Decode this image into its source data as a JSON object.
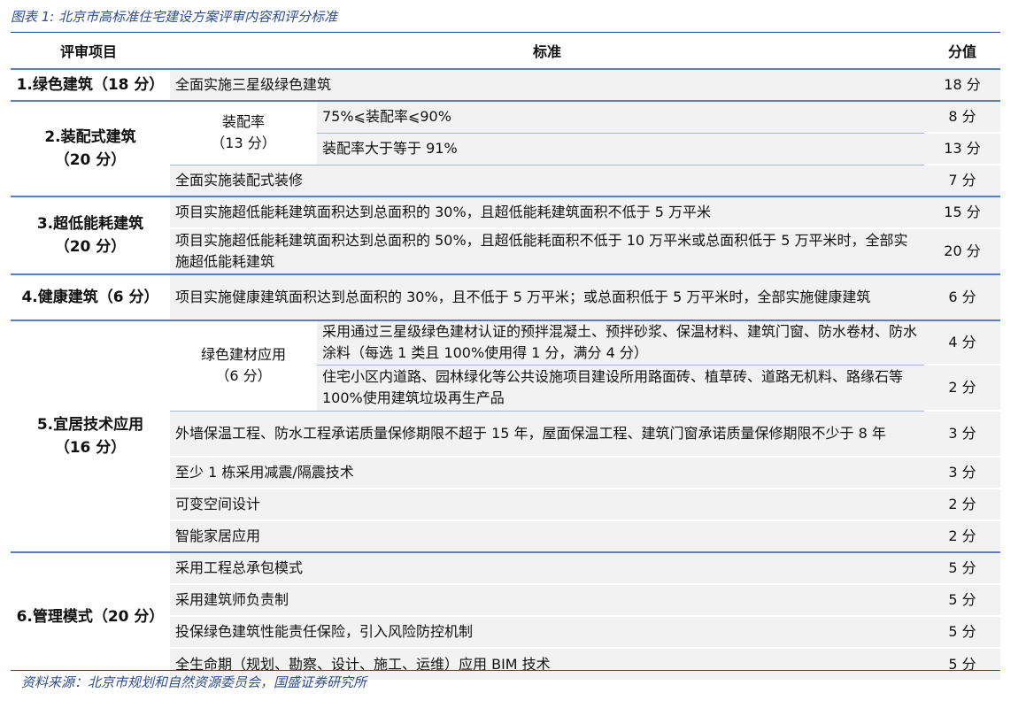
{
  "caption": "图表 1:  北京市高标准住宅建设方案评审内容和评分标准",
  "headers": {
    "item": "评审项目",
    "standard": "标准",
    "score": "分值"
  },
  "groups": [
    {
      "category": "1.绿色建筑（18 分）",
      "rows": [
        {
          "desc": "全面实施三星级绿色建筑",
          "score": "18 分"
        }
      ]
    },
    {
      "category": "2.装配式建筑\n（20 分）",
      "sub": "装配率\n（13 分）",
      "subrows": [
        {
          "desc": "75%⩽装配率⩽90%",
          "score": "8 分"
        },
        {
          "desc": "装配率大于等于 91%",
          "score": "13 分"
        }
      ],
      "rows": [
        {
          "desc": "全面实施装配式装修",
          "score": "7 分"
        }
      ]
    },
    {
      "category": "3.超低能耗建筑\n（20 分）",
      "rows": [
        {
          "desc": "项目实施超低能耗建筑面积达到总面积的 30%，且超低能耗建筑面积不低于 5 万平米",
          "score": "15 分"
        },
        {
          "desc": "项目实施超低能耗建筑面积达到总面积的 50%，且超低能耗面积不低于 10 万平米或总面积低于 5 万平米时，全部实施超低能耗建筑",
          "score": "20 分"
        }
      ]
    },
    {
      "category": "4.健康建筑（6 分）",
      "rows": [
        {
          "desc": "项目实施健康建筑面积达到总面积的 30%，且不低于 5 万平米；或总面积低于 5 万平米时，全部实施健康建筑",
          "score": "6 分"
        }
      ]
    },
    {
      "category": "5.宜居技术应用\n（16 分）",
      "sub": "绿色建材应用\n（6 分）",
      "subrows": [
        {
          "desc": "采用通过三星级绿色建材认证的预拌混凝土、预拌砂浆、保温材料、建筑门窗、防水卷材、防水涂料（每选 1 类且 100%使用得 1 分，满分 4 分）",
          "score": "4 分"
        },
        {
          "desc": "住宅小区内道路、园林绿化等公共设施项目建设所用路面砖、植草砖、道路无机料、路缘石等 100%使用建筑垃圾再生产品",
          "score": "2 分"
        }
      ],
      "rows": [
        {
          "desc": "外墙保温工程、防水工程承诺质量保修期限不超于 15 年，屋面保温工程、建筑门窗承诺质量保修期限不少于 8 年",
          "score": "3 分"
        },
        {
          "desc": "至少 1 栋采用减震/隔震技术",
          "score": "3 分"
        },
        {
          "desc": "可变空间设计",
          "score": "2 分"
        },
        {
          "desc": "智能家居应用",
          "score": "2 分"
        }
      ]
    },
    {
      "category": "6.管理模式（20 分）",
      "rows": [
        {
          "desc": "采用工程总承包模式",
          "score": "5 分"
        },
        {
          "desc": "采用建筑师负责制",
          "score": "5 分"
        },
        {
          "desc": "投保绿色建筑性能责任保险，引入风险防控机制",
          "score": "5 分"
        },
        {
          "desc": "全生命期（规划、勘察、设计、施工、运维）应用 BIM 技术",
          "score": "5 分"
        }
      ]
    }
  ],
  "source": "资料来源：北京市规划和自然资源委员会，国盛证券研究所"
}
